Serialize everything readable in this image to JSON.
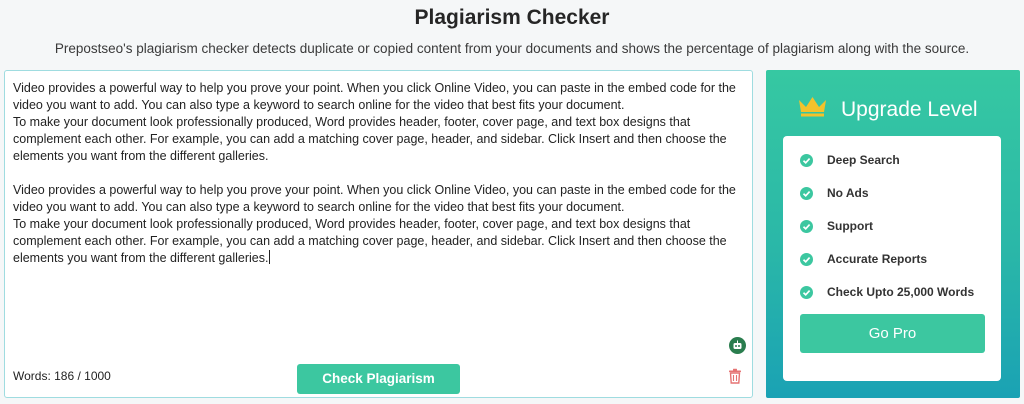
{
  "header": {
    "title": "Plagiarism Checker",
    "subtitle": "Prepostseo's plagiarism checker detects duplicate or copied content from your documents and shows the percentage of plagiarism along with the source."
  },
  "editor": {
    "text": "Video provides a powerful way to help you prove your point. When you click Online Video, you can paste in the embed code for the video you want to add. You can also type a keyword to search online for the video that best fits your document.\nTo make your document look professionally produced, Word provides header, footer, cover page, and text box designs that complement each other. For example, you can add a matching cover page, header, and sidebar. Click Insert and then choose the elements you want from the different galleries.\n\nVideo provides a powerful way to help you prove your point. When you click Online Video, you can paste in the embed code for the video you want to add. You can also type a keyword to search online for the video that best fits your document.\nTo make your document look professionally produced, Word provides header, footer, cover page, and text box designs that complement each other. For example, you can add a matching cover page, header, and sidebar. Click Insert and then choose the elements you want from the different galleries.",
    "word_count": "Words: 186 / 1000",
    "check_button": "Check Plagiarism",
    "icons": [
      "robot-icon",
      "trash-icon"
    ]
  },
  "upgrade": {
    "title": "Upgrade Level",
    "features": [
      "Deep Search",
      "No Ads",
      "Support",
      "Accurate Reports",
      "Check Upto 25,000 Words"
    ],
    "button": "Go Pro",
    "icons": [
      "crown-icon",
      "check-circle-icon"
    ]
  },
  "colors": {
    "accent": "#3cc7a0",
    "panel_top": "#36c8a2",
    "panel_bottom": "#1aa2b4",
    "editor_border": "#9fdce0",
    "crown": "#f4c22b",
    "trash": "#e57373",
    "bot": "#2a7d4e"
  }
}
